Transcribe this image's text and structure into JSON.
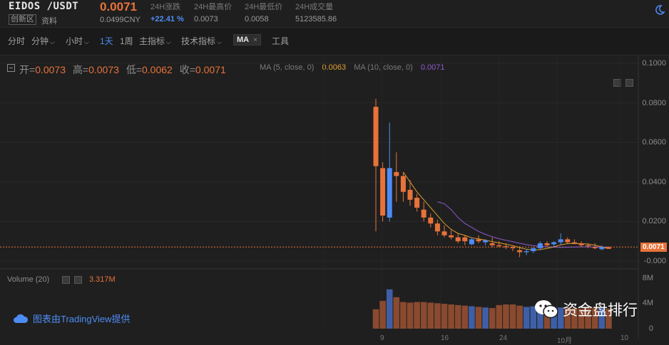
{
  "header": {
    "pair": "EIDOS /USDT",
    "price": "0.0071",
    "board_badge": "创新区",
    "info_link": "资料",
    "cny_price": "0.0499CNY",
    "stats": [
      {
        "label": "24H涨跌",
        "value": "+22.41 %"
      },
      {
        "label": "24H最高价",
        "value": "0.0073"
      },
      {
        "label": "24H最低价",
        "value": "0.0058"
      },
      {
        "label": "24H成交量",
        "value": "5123585.86"
      }
    ]
  },
  "toolbar": {
    "items": [
      "分时",
      "分钟",
      "小时",
      "1天",
      "1周",
      "主指标",
      "技术指标"
    ],
    "active_item": "1天",
    "ma_tag": "MA",
    "ma_close": "×",
    "tools": "工具"
  },
  "ohlc": {
    "open_label": "开=",
    "open": "0.0073",
    "high_label": "高=",
    "high": "0.0073",
    "low_label": "低=",
    "low": "0.0062",
    "close_label": "收=",
    "close": "0.0071",
    "ma5_label": "MA (5, close, 0)",
    "ma5_value": "0.0063",
    "ma10_label": "MA (10, close, 0)",
    "ma10_value": "0.0071"
  },
  "price_axis": [
    "0.1000",
    "0.0800",
    "0.0600",
    "0.0400",
    "0.0200",
    "-0.000"
  ],
  "last_price_tag": "0.0071",
  "volume": {
    "label": "Volume (20)",
    "value": "3.317M",
    "axis": [
      "8M",
      "4M",
      "0"
    ]
  },
  "time_axis": [
    "9",
    "16",
    "24",
    "10月",
    "10"
  ],
  "credit": "图表由TradingView提供",
  "watermark": "资金盘排行",
  "colors": {
    "up": "#e8723a",
    "down": "#4d8cf5",
    "ma5": "#e0a030",
    "ma10": "#8f5bd0",
    "bg": "#1f1f1f"
  },
  "chart_data": {
    "type": "candlestick",
    "ylim": [
      0,
      0.1
    ],
    "candles": [
      {
        "o": 0.048,
        "h": 0.082,
        "l": 0.015,
        "c": 0.078,
        "dir": "up"
      },
      {
        "o": 0.047,
        "h": 0.05,
        "l": 0.02,
        "c": 0.023,
        "dir": "up"
      },
      {
        "o": 0.022,
        "h": 0.07,
        "l": 0.02,
        "c": 0.047,
        "dir": "down"
      },
      {
        "o": 0.045,
        "h": 0.055,
        "l": 0.03,
        "c": 0.043,
        "dir": "up"
      },
      {
        "o": 0.043,
        "h": 0.045,
        "l": 0.03,
        "c": 0.035,
        "dir": "up"
      },
      {
        "o": 0.036,
        "h": 0.041,
        "l": 0.028,
        "c": 0.031,
        "dir": "up"
      },
      {
        "o": 0.032,
        "h": 0.034,
        "l": 0.025,
        "c": 0.027,
        "dir": "up"
      },
      {
        "o": 0.026,
        "h": 0.03,
        "l": 0.02,
        "c": 0.022,
        "dir": "up"
      },
      {
        "o": 0.022,
        "h": 0.024,
        "l": 0.017,
        "c": 0.019,
        "dir": "up"
      },
      {
        "o": 0.019,
        "h": 0.021,
        "l": 0.013,
        "c": 0.015,
        "dir": "up"
      },
      {
        "o": 0.015,
        "h": 0.018,
        "l": 0.012,
        "c": 0.013,
        "dir": "up"
      },
      {
        "o": 0.013,
        "h": 0.016,
        "l": 0.011,
        "c": 0.012,
        "dir": "up"
      },
      {
        "o": 0.012,
        "h": 0.014,
        "l": 0.009,
        "c": 0.01,
        "dir": "up"
      },
      {
        "o": 0.01,
        "h": 0.013,
        "l": 0.008,
        "c": 0.012,
        "dir": "up"
      },
      {
        "o": 0.0085,
        "h": 0.012,
        "l": 0.008,
        "c": 0.011,
        "dir": "down"
      },
      {
        "o": 0.011,
        "h": 0.013,
        "l": 0.009,
        "c": 0.01,
        "dir": "up"
      },
      {
        "o": 0.0095,
        "h": 0.011,
        "l": 0.008,
        "c": 0.0105,
        "dir": "down"
      },
      {
        "o": 0.009,
        "h": 0.012,
        "l": 0.007,
        "c": 0.008,
        "dir": "up"
      },
      {
        "o": 0.008,
        "h": 0.01,
        "l": 0.007,
        "c": 0.0075,
        "dir": "up"
      },
      {
        "o": 0.0075,
        "h": 0.009,
        "l": 0.006,
        "c": 0.007,
        "dir": "up"
      },
      {
        "o": 0.007,
        "h": 0.008,
        "l": 0.005,
        "c": 0.0065,
        "dir": "up"
      },
      {
        "o": 0.0055,
        "h": 0.0075,
        "l": 0.002,
        "c": 0.0045,
        "dir": "up"
      },
      {
        "o": 0.0045,
        "h": 0.006,
        "l": 0.003,
        "c": 0.005,
        "dir": "down"
      },
      {
        "o": 0.005,
        "h": 0.007,
        "l": 0.004,
        "c": 0.0065,
        "dir": "down"
      },
      {
        "o": 0.0065,
        "h": 0.01,
        "l": 0.0055,
        "c": 0.009,
        "dir": "down"
      },
      {
        "o": 0.009,
        "h": 0.01,
        "l": 0.007,
        "c": 0.008,
        "dir": "up"
      },
      {
        "o": 0.0085,
        "h": 0.01,
        "l": 0.007,
        "c": 0.0095,
        "dir": "down"
      },
      {
        "o": 0.0095,
        "h": 0.014,
        "l": 0.008,
        "c": 0.011,
        "dir": "down"
      },
      {
        "o": 0.011,
        "h": 0.012,
        "l": 0.009,
        "c": 0.0095,
        "dir": "up"
      },
      {
        "o": 0.0095,
        "h": 0.011,
        "l": 0.0085,
        "c": 0.009,
        "dir": "up"
      },
      {
        "o": 0.009,
        "h": 0.01,
        "l": 0.007,
        "c": 0.008,
        "dir": "up"
      },
      {
        "o": 0.008,
        "h": 0.009,
        "l": 0.0065,
        "c": 0.0075,
        "dir": "up"
      },
      {
        "o": 0.007,
        "h": 0.009,
        "l": 0.006,
        "c": 0.0065,
        "dir": "up"
      },
      {
        "o": 0.006,
        "h": 0.008,
        "l": 0.0055,
        "c": 0.007,
        "dir": "down"
      },
      {
        "o": 0.0062,
        "h": 0.0073,
        "l": 0.0062,
        "c": 0.0071,
        "dir": "up"
      }
    ],
    "ma5": [
      null,
      null,
      null,
      null,
      0.045,
      0.04,
      0.035,
      0.031,
      0.027,
      0.023,
      0.019,
      0.016,
      0.014,
      0.013,
      0.0118,
      0.0112,
      0.0106,
      0.0098,
      0.0092,
      0.0085,
      0.0078,
      0.0068,
      0.006,
      0.0056,
      0.0058,
      0.0064,
      0.0072,
      0.0082,
      0.0088,
      0.0089,
      0.0088,
      0.0086,
      0.008,
      0.0072,
      0.0063
    ],
    "ma10": [
      null,
      null,
      null,
      null,
      null,
      null,
      null,
      null,
      null,
      0.03,
      0.029,
      0.026,
      0.022,
      0.019,
      0.017,
      0.015,
      0.0135,
      0.0123,
      0.0113,
      0.0105,
      0.0098,
      0.009,
      0.0083,
      0.0078,
      0.0075,
      0.0072,
      0.007,
      0.0069,
      0.007,
      0.0071,
      0.0072,
      0.0072,
      0.0071,
      0.007,
      0.0071
    ],
    "volume": [
      3.2,
      4.6,
      6.5,
      5.2,
      4.4,
      4.3,
      4.4,
      4.4,
      4.3,
      4.2,
      4.1,
      4.0,
      3.9,
      3.8,
      3.7,
      3.6,
      3.5,
      3.4,
      3.9,
      4.0,
      4.0,
      3.8,
      3.6,
      3.7,
      3.5,
      3.4,
      3.6,
      3.5,
      3.5,
      3.4,
      3.3,
      3.5,
      3.4,
      3.5,
      3.317
    ],
    "volume_unit": "M",
    "volume_ylim": [
      0,
      8
    ]
  }
}
